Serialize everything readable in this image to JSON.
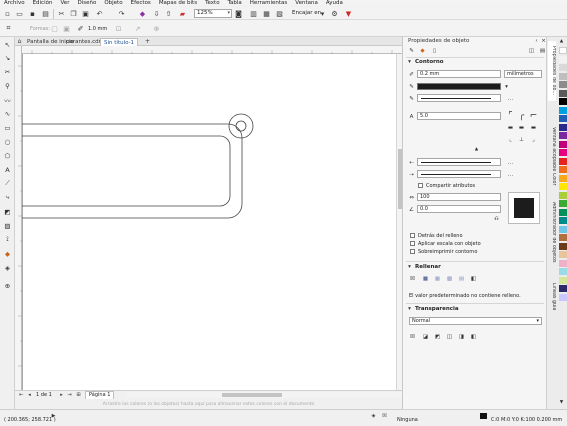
{
  "menu": [
    "Archivo",
    "Edición",
    "Ver",
    "Diseño",
    "Objeto",
    "Efectos",
    "Mapas de bits",
    "Texto",
    "Tabla",
    "Herramientas",
    "Ventana",
    "Ayuda"
  ],
  "toolbar": {
    "zoom": "125%",
    "snap_label": "Encajar en",
    "shape_label": "Formas:",
    "outline_width": "1.0 mm"
  },
  "tabs": {
    "welcome": "Pantalla de inicio",
    "doc1": "parantes.cdr",
    "doc2": "Sin título-1"
  },
  "pagebar": {
    "page_counter": "1 de 1",
    "page_tab": "Página 1"
  },
  "hint": "Arrastre los colores (o los objetos) hasta aquí para almacenar estos colores con el documento",
  "status": {
    "coords": "( 200.365; 258.721 )",
    "fill": "Ninguna",
    "outline": "C:0 M:0 Y:0 K:100  0.200 mm"
  },
  "docker": {
    "title": "Propiedades de objeto",
    "outline_head": "Contorno",
    "width_value": "0.2 mm",
    "units": "milímetros",
    "miter_value": "5.0",
    "compound_label": "Compartir atributos",
    "stretch_value": "100",
    "angle_value": "0.0",
    "behind_fill": "Detrás del relleno",
    "scale_with": "Aplicar escala con objeto",
    "overprint": "Sobreimprimir contorno",
    "fill_head": "Rellenar",
    "fill_note": "El valor predeterminado no contiene relleno.",
    "transp_head": "Transparencia",
    "transp_mode": "Normal"
  },
  "side_tabs": [
    "Propiedades de ob...",
    "Ventana acoplable Color",
    "Administrador de objetos",
    "Líneas guía"
  ],
  "palette_colors": [
    "#ffffff",
    "#f2f2f2",
    "#d9d9d9",
    "#bfbfbf",
    "#8c8c8c",
    "#5a5a5a",
    "#000000",
    "#00a0e3",
    "#1f5fb8",
    "#2a2a8c",
    "#7a2aa0",
    "#c0007a",
    "#e6007e",
    "#e52420",
    "#f06e1e",
    "#f7a81b",
    "#ffe600",
    "#a8cf3a",
    "#3aaa35",
    "#00915a",
    "#008b8b",
    "#6fc7e8",
    "#b07040",
    "#6b3b1a",
    "#e8c49a",
    "#f0b0c8",
    "#9adbe8",
    "#d4e89a",
    "#2b2b6b",
    "#c8c8ff"
  ]
}
